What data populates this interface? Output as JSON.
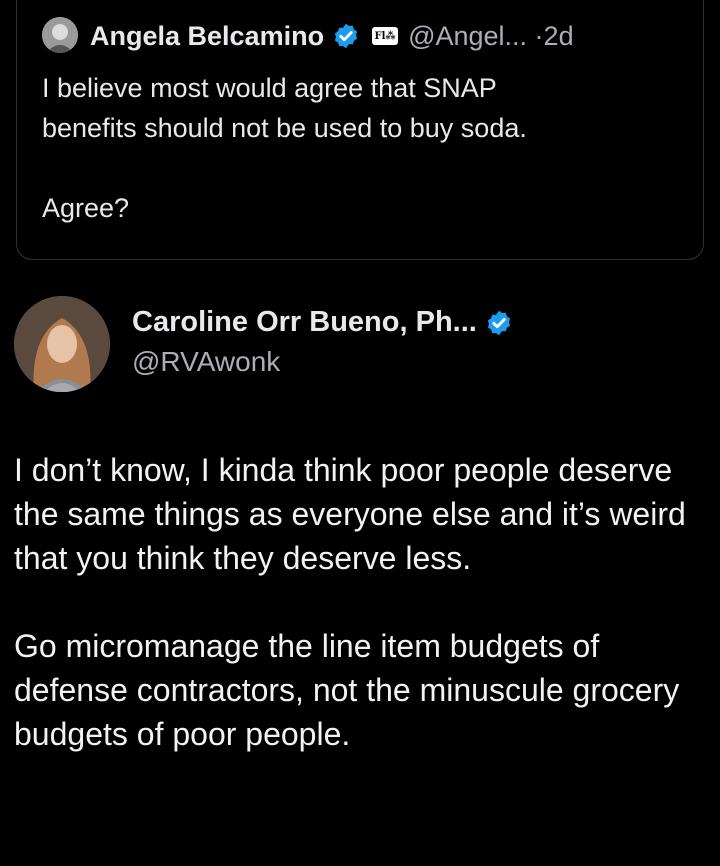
{
  "quoted_post": {
    "display_name": "Angela Belcamino",
    "affiliation_badge": "Fl⁂",
    "handle": "@Angel...",
    "separator": "·",
    "time": "2d",
    "text": "I believe most would agree that SNAP\nbenefits should not be used to buy soda.\n\nAgree?"
  },
  "reply_post": {
    "display_name": "Caroline Orr Bueno, Ph...",
    "handle": "@RVAwonk",
    "paragraphs": [
      "I don’t know, I kinda think poor people deserve the same things as everyone else and it’s weird that you think they deserve less.",
      "Go micromanage the line item budgets of defense contractors, not the minuscule grocery budgets of poor people."
    ]
  },
  "colors": {
    "background": "#000000",
    "text": "#e7e9ea",
    "secondary_text": "#a9afb4",
    "verified_blue": "#1d9bf0",
    "border": "#2f3336"
  },
  "icons": [
    "verified-badge-icon",
    "affiliation-badge-icon"
  ]
}
